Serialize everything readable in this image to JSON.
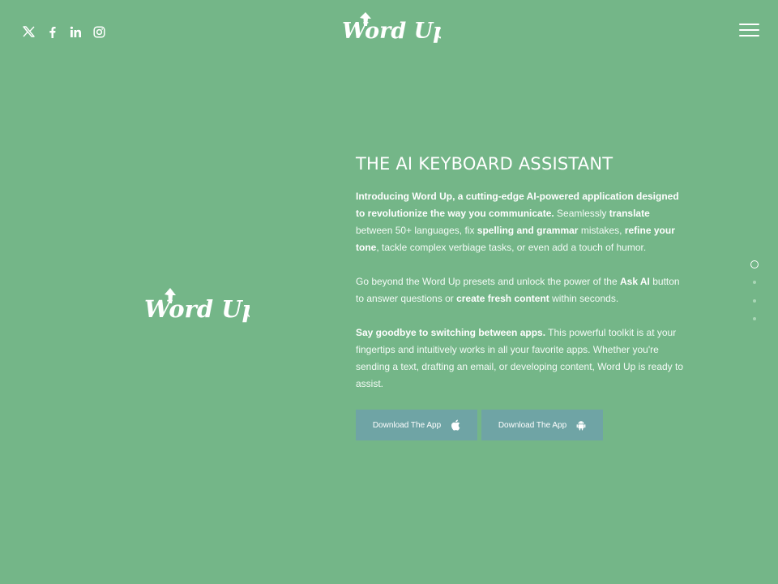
{
  "header": {
    "social_icons": [
      "x-twitter-icon",
      "facebook-icon",
      "linkedin-icon",
      "instagram-icon"
    ],
    "logo_text": "Word Up",
    "menu_icon": "hamburger-menu-icon"
  },
  "hero_logo_text": "Word Up",
  "content": {
    "headline": "THE AI KEYBOARD ASSISTANT",
    "p1": {
      "b1": "Introducing Word Up, a cutting-edge AI-powered application designed to revolutionize the way you communicate.",
      "t1": " Seamlessly ",
      "b2": "translate",
      "t2": " between 50+ languages, fix ",
      "b3": "spelling and grammar",
      "t3": " mistakes, ",
      "b4": "refine your tone",
      "t4": ", tackle complex verbiage tasks, or even add a touch of humor."
    },
    "p2": {
      "t1": "Go beyond the Word Up presets and unlock the power of the ",
      "b1": "Ask AI",
      "t2": " button to answer questions or ",
      "b2": "create fresh content",
      "t3": " within seconds."
    },
    "p3": {
      "b1": "Say goodbye to switching between apps.",
      "t1": " This powerful toolkit is at your fingertips and intuitively works in all your favorite apps. Whether you're sending a text, drafting an email, or developing content, Word Up is ready to assist."
    },
    "buttons": [
      {
        "label": "Download The App",
        "icon": "apple-icon"
      },
      {
        "label": "Download The App",
        "icon": "android-icon"
      }
    ]
  },
  "page_nav": {
    "count": 4,
    "active_index": 0
  },
  "colors": {
    "background": "#74b688",
    "button": "#6fa4a5",
    "text": "#ffffff"
  }
}
